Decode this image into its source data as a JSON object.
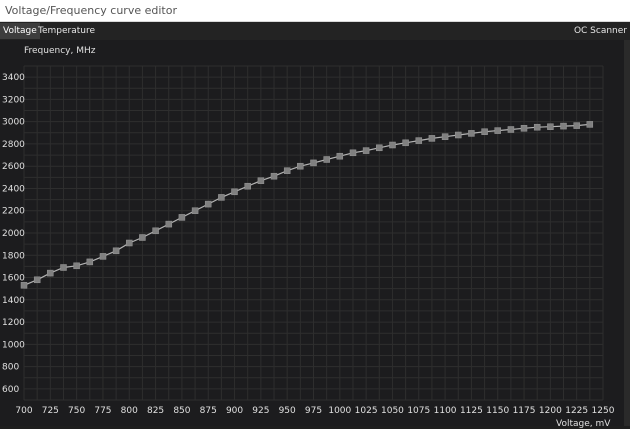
{
  "window": {
    "title": "Voltage/Frequency curve editor"
  },
  "tabs": [
    {
      "label": "Voltage",
      "active": true
    },
    {
      "label": "Temperature",
      "active": false
    }
  ],
  "oc_scanner_label": "OC Scanner",
  "colors": {
    "background": "#1c1c1e",
    "grid": "#2e2e2e",
    "curve": "#b4b4b4",
    "point": "#808080",
    "text": "#e0e0e0"
  },
  "chart_data": {
    "type": "line",
    "title": "",
    "xlabel": "Voltage, mV",
    "ylabel": "Frequency, MHz",
    "xlim": [
      700,
      1250
    ],
    "ylim": [
      500,
      3500
    ],
    "xticks": [
      700,
      725,
      750,
      775,
      800,
      825,
      850,
      875,
      900,
      925,
      950,
      975,
      1000,
      1025,
      1050,
      1075,
      1100,
      1125,
      1150,
      1175,
      1200,
      1225,
      1250
    ],
    "yticks": [
      600,
      800,
      1000,
      1200,
      1400,
      1600,
      1800,
      2000,
      2200,
      2400,
      2600,
      2800,
      3000,
      3200,
      3400
    ],
    "grid": true,
    "x": [
      700,
      712.5,
      725,
      737.5,
      750,
      762.5,
      775,
      787.5,
      800,
      812.5,
      825,
      837.5,
      850,
      862.5,
      875,
      887.5,
      900,
      912.5,
      925,
      937.5,
      950,
      962.5,
      975,
      987.5,
      1000,
      1012.5,
      1025,
      1037.5,
      1050,
      1062.5,
      1075,
      1087.5,
      1100,
      1112.5,
      1125,
      1137.5,
      1150,
      1162.5,
      1175,
      1187.5,
      1200,
      1212.5,
      1225,
      1237.5
    ],
    "series": [
      {
        "values": [
          1530,
          1580,
          1640,
          1690,
          1705,
          1740,
          1790,
          1840,
          1910,
          1960,
          2020,
          2080,
          2140,
          2200,
          2260,
          2320,
          2370,
          2420,
          2470,
          2510,
          2560,
          2600,
          2630,
          2660,
          2690,
          2720,
          2740,
          2765,
          2790,
          2810,
          2830,
          2850,
          2865,
          2880,
          2895,
          2910,
          2920,
          2930,
          2940,
          2950,
          2955,
          2960,
          2965,
          2975
        ]
      }
    ]
  }
}
